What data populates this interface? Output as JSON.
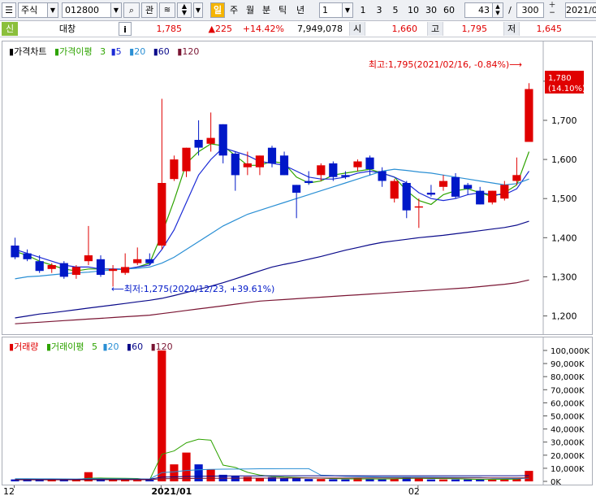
{
  "toolbar": {
    "market": "주식",
    "code": "012800",
    "btn_gwan": "관",
    "periods": [
      "일",
      "주",
      "월",
      "분",
      "틱",
      "년"
    ],
    "interval": "1",
    "quick": [
      "1",
      "3",
      "5",
      "10",
      "30",
      "60"
    ],
    "count": "43",
    "slash": "/",
    "total": "300",
    "date": "2021/0"
  },
  "info": {
    "badge": "신",
    "name": "대창",
    "i": "i",
    "price": "1,785",
    "change": "▲225",
    "rate": "+14.42%",
    "volume": "7,949,078",
    "open_label": "시",
    "open": "1,660",
    "high_label": "고",
    "high": "1,795",
    "low_label": "저",
    "low": "1,645"
  },
  "price_panel": {
    "title": "가격차트",
    "ma_label": "가격이평",
    "ma_periods": [
      "3",
      "5",
      "20",
      "60",
      "120"
    ],
    "high_note": "최고:1,795(2021/02/16, -0.84%)⟶",
    "low_note": "⟵최저:1,275(2020/12/23, +39.61%)",
    "current_price": "1,780",
    "current_rate": "(14.10%)"
  },
  "volume_panel": {
    "title": "거래량",
    "ma_label": "거래이평",
    "ma_periods": [
      "5",
      "20",
      "60",
      "120"
    ]
  },
  "colors": {
    "up": "#e00000",
    "down": "#0018c8",
    "ma3": "#2ea300",
    "ma5": "#1b2bd6",
    "ma20": "#2a8fd4",
    "ma60": "#0a0a8a",
    "ma120": "#7a1533"
  },
  "chart_data": {
    "type": "candlestick",
    "x_ticks": [
      "12",
      "2021/01",
      "02"
    ],
    "price_axis": {
      "ticks": [
        "1,800",
        "1,700",
        "1,600",
        "1,500",
        "1,400",
        "1,300",
        "1,200"
      ],
      "values": [
        1800,
        1700,
        1600,
        1500,
        1400,
        1300,
        1200
      ],
      "ylim": [
        1170,
        1860
      ]
    },
    "candles": [
      {
        "o": 1380,
        "h": 1400,
        "l": 1345,
        "c": 1350
      },
      {
        "o": 1360,
        "h": 1370,
        "l": 1340,
        "c": 1345
      },
      {
        "o": 1340,
        "h": 1355,
        "l": 1310,
        "c": 1315
      },
      {
        "o": 1320,
        "h": 1335,
        "l": 1310,
        "c": 1330
      },
      {
        "o": 1335,
        "h": 1340,
        "l": 1295,
        "c": 1300
      },
      {
        "o": 1305,
        "h": 1330,
        "l": 1295,
        "c": 1325
      },
      {
        "o": 1340,
        "h": 1430,
        "l": 1330,
        "c": 1355
      },
      {
        "o": 1345,
        "h": 1355,
        "l": 1300,
        "c": 1305
      },
      {
        "o": 1315,
        "h": 1330,
        "l": 1275,
        "c": 1320
      },
      {
        "o": 1310,
        "h": 1360,
        "l": 1305,
        "c": 1325
      },
      {
        "o": 1335,
        "h": 1375,
        "l": 1330,
        "c": 1345
      },
      {
        "o": 1345,
        "h": 1360,
        "l": 1330,
        "c": 1335
      },
      {
        "o": 1380,
        "h": 1755,
        "l": 1370,
        "c": 1540
      },
      {
        "o": 1550,
        "h": 1610,
        "l": 1545,
        "c": 1600
      },
      {
        "o": 1570,
        "h": 1630,
        "l": 1555,
        "c": 1630
      },
      {
        "o": 1650,
        "h": 1700,
        "l": 1610,
        "c": 1630
      },
      {
        "o": 1640,
        "h": 1720,
        "l": 1620,
        "c": 1655
      },
      {
        "o": 1690,
        "h": 1690,
        "l": 1590,
        "c": 1610
      },
      {
        "o": 1615,
        "h": 1620,
        "l": 1520,
        "c": 1560
      },
      {
        "o": 1580,
        "h": 1620,
        "l": 1560,
        "c": 1590
      },
      {
        "o": 1580,
        "h": 1610,
        "l": 1560,
        "c": 1610
      },
      {
        "o": 1630,
        "h": 1635,
        "l": 1580,
        "c": 1590
      },
      {
        "o": 1610,
        "h": 1620,
        "l": 1560,
        "c": 1560
      },
      {
        "o": 1535,
        "h": 1535,
        "l": 1450,
        "c": 1515
      },
      {
        "o": 1545,
        "h": 1570,
        "l": 1535,
        "c": 1540
      },
      {
        "o": 1560,
        "h": 1590,
        "l": 1545,
        "c": 1585
      },
      {
        "o": 1590,
        "h": 1595,
        "l": 1545,
        "c": 1555
      },
      {
        "o": 1560,
        "h": 1570,
        "l": 1550,
        "c": 1555
      },
      {
        "o": 1580,
        "h": 1600,
        "l": 1570,
        "c": 1595
      },
      {
        "o": 1605,
        "h": 1610,
        "l": 1560,
        "c": 1575
      },
      {
        "o": 1570,
        "h": 1580,
        "l": 1530,
        "c": 1545
      },
      {
        "o": 1500,
        "h": 1550,
        "l": 1490,
        "c": 1545
      },
      {
        "o": 1540,
        "h": 1545,
        "l": 1450,
        "c": 1470
      },
      {
        "o": 1480,
        "h": 1500,
        "l": 1425,
        "c": 1480
      },
      {
        "o": 1515,
        "h": 1535,
        "l": 1505,
        "c": 1510
      },
      {
        "o": 1530,
        "h": 1560,
        "l": 1520,
        "c": 1545
      },
      {
        "o": 1555,
        "h": 1565,
        "l": 1500,
        "c": 1505
      },
      {
        "o": 1535,
        "h": 1540,
        "l": 1510,
        "c": 1525
      },
      {
        "o": 1520,
        "h": 1530,
        "l": 1485,
        "c": 1485
      },
      {
        "o": 1490,
        "h": 1520,
        "l": 1485,
        "c": 1520
      },
      {
        "o": 1500,
        "h": 1545,
        "l": 1495,
        "c": 1535
      },
      {
        "o": 1545,
        "h": 1605,
        "l": 1535,
        "c": 1560
      },
      {
        "o": 1645,
        "h": 1795,
        "l": 1645,
        "c": 1780
      }
    ],
    "ma": [
      {
        "period": "3",
        "values": [
          1365,
          1355,
          1340,
          1330,
          1320,
          1315,
          1320,
          1320,
          1320,
          1318,
          1325,
          1335,
          1410,
          1495,
          1590,
          1620,
          1640,
          1635,
          1610,
          1585,
          1585,
          1595,
          1590,
          1555,
          1540,
          1545,
          1560,
          1565,
          1570,
          1575,
          1565,
          1555,
          1520,
          1495,
          1485,
          1510,
          1520,
          1525,
          1515,
          1505,
          1515,
          1535,
          1620
        ]
      },
      {
        "period": "5",
        "values": [
          1370,
          1360,
          1350,
          1340,
          1330,
          1325,
          1325,
          1320,
          1320,
          1320,
          1325,
          1330,
          1370,
          1420,
          1490,
          1560,
          1600,
          1630,
          1620,
          1610,
          1595,
          1590,
          1585,
          1570,
          1555,
          1550,
          1550,
          1555,
          1565,
          1570,
          1565,
          1555,
          1540,
          1515,
          1500,
          1495,
          1500,
          1510,
          1515,
          1510,
          1510,
          1525,
          1570
        ]
      },
      {
        "period": "20",
        "values": [
          1295,
          1300,
          1302,
          1305,
          1308,
          1310,
          1312,
          1315,
          1318,
          1320,
          1322,
          1325,
          1335,
          1350,
          1370,
          1390,
          1410,
          1430,
          1445,
          1460,
          1470,
          1480,
          1490,
          1500,
          1510,
          1520,
          1530,
          1540,
          1550,
          1560,
          1570,
          1575,
          1572,
          1568,
          1565,
          1560,
          1555,
          1550,
          1545,
          1540,
          1535,
          1538,
          1550
        ]
      },
      {
        "period": "60",
        "values": [
          1195,
          1200,
          1205,
          1208,
          1212,
          1216,
          1220,
          1224,
          1228,
          1232,
          1236,
          1240,
          1245,
          1252,
          1260,
          1268,
          1276,
          1285,
          1295,
          1305,
          1315,
          1325,
          1332,
          1338,
          1345,
          1352,
          1360,
          1368,
          1375,
          1382,
          1388,
          1392,
          1396,
          1400,
          1403,
          1406,
          1410,
          1414,
          1418,
          1422,
          1426,
          1432,
          1442
        ]
      },
      {
        "period": "120",
        "values": [
          1180,
          1182,
          1184,
          1186,
          1188,
          1190,
          1192,
          1194,
          1196,
          1198,
          1200,
          1202,
          1206,
          1210,
          1214,
          1218,
          1222,
          1226,
          1230,
          1234,
          1238,
          1240,
          1242,
          1244,
          1246,
          1248,
          1250,
          1252,
          1254,
          1256,
          1258,
          1260,
          1262,
          1264,
          1266,
          1268,
          1270,
          1272,
          1275,
          1278,
          1281,
          1285,
          1292
        ]
      }
    ],
    "volume_axis": {
      "ticks": [
        "100,000K",
        "90,000K",
        "80,000K",
        "70,000K",
        "60,000K",
        "50,000K",
        "40,000K",
        "30,000K",
        "20,000K",
        "10,000K",
        "0K"
      ],
      "values": [
        100000,
        90000,
        80000,
        70000,
        60000,
        50000,
        40000,
        30000,
        20000,
        10000,
        0
      ],
      "ylim": [
        0,
        100000
      ]
    },
    "volume": [
      1500,
      1800,
      1200,
      1500,
      1300,
      1200,
      7000,
      1500,
      1200,
      1000,
      900,
      1200,
      100000,
      13000,
      22000,
      13000,
      9000,
      5000,
      4000,
      3500,
      2800,
      3200,
      2500,
      3000,
      1800,
      1800,
      1600,
      1500,
      2500,
      2000,
      1500,
      2000,
      3200,
      2600,
      1500,
      1400,
      1500,
      1400,
      1800,
      1400,
      1600,
      2500,
      8000
    ],
    "volume_ma": [
      {
        "period": "5",
        "values": [
          1500,
          1600,
          1500,
          1500,
          1460,
          1400,
          2440,
          2540,
          2440,
          2380,
          2160,
          1160,
          20660,
          23260,
          29420,
          32220,
          31400,
          12400,
          10600,
          6900,
          4860,
          3700,
          3200,
          3000,
          2660,
          2460,
          2140,
          1940,
          1840,
          1880,
          1820,
          1900,
          2240,
          2360,
          2160,
          2140,
          2040,
          1680,
          1520,
          1500,
          1540,
          1680,
          2960
        ]
      },
      {
        "period": "20",
        "values": [
          2000,
          2000,
          1950,
          1900,
          1850,
          1800,
          2000,
          2000,
          1950,
          1900,
          1850,
          1800,
          6700,
          7300,
          8300,
          8900,
          9200,
          9300,
          9400,
          9500,
          9600,
          9600,
          9700,
          9700,
          9700,
          4750,
          4400,
          3850,
          3700,
          3500,
          3300,
          3250,
          3250,
          3200,
          3150,
          3100,
          3050,
          3000,
          2950,
          2300,
          2250,
          2200,
          2450
        ]
      },
      {
        "period": "60",
        "values": [
          1500,
          1500,
          1500,
          1500,
          1500,
          1500,
          1600,
          1600,
          1600,
          1600,
          1600,
          1600,
          3200,
          3400,
          3700,
          3900,
          4000,
          4100,
          4200,
          4200,
          4200,
          4300,
          4300,
          4300,
          4300,
          4300,
          4300,
          4300,
          4300,
          4300,
          4300,
          4300,
          4300,
          4300,
          4300,
          4300,
          4300,
          4300,
          4300,
          4300,
          4300,
          4300,
          4400
        ]
      },
      {
        "period": "120",
        "values": [
          1200,
          1200,
          1200,
          1200,
          1200,
          1200,
          1250,
          1250,
          1250,
          1250,
          1250,
          1250,
          2000,
          2100,
          2200,
          2300,
          2350,
          2400,
          2450,
          2500,
          2500,
          2500,
          2500,
          2550,
          2550,
          2550,
          2550,
          2550,
          2600,
          2600,
          2600,
          2600,
          2600,
          2600,
          2650,
          2650,
          2650,
          2650,
          2650,
          2650,
          2700,
          2700,
          2750
        ]
      }
    ]
  }
}
